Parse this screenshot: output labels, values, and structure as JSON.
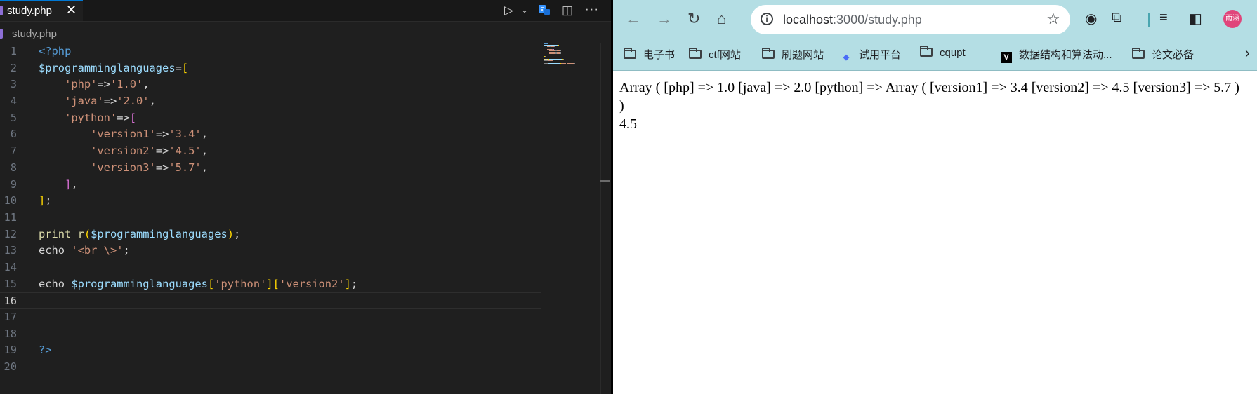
{
  "editor": {
    "tab_label": "study.php",
    "tab_close": "✕",
    "breadcrumb": "study.php",
    "toolbar": {
      "run_icon": "▷",
      "run_menu": "⌄",
      "split_icon": "◫",
      "more_icon": "···"
    },
    "current_line": 16,
    "line_numbers": [
      "1",
      "2",
      "3",
      "4",
      "5",
      "6",
      "7",
      "8",
      "9",
      "10",
      "11",
      "12",
      "13",
      "14",
      "15",
      "16",
      "17",
      "18",
      "19",
      "20"
    ],
    "code": [
      [
        [
          "<?php",
          "php"
        ]
      ],
      [
        [
          "$programminglanguages",
          "var"
        ],
        [
          "=",
          "op"
        ],
        [
          "[",
          "br1"
        ]
      ],
      [
        [
          "    ",
          "op"
        ],
        [
          "'php'",
          "str"
        ],
        [
          "=>",
          "op"
        ],
        [
          "'1.0'",
          "str"
        ],
        [
          ",",
          "op"
        ]
      ],
      [
        [
          "    ",
          "op"
        ],
        [
          "'java'",
          "str"
        ],
        [
          "=>",
          "op"
        ],
        [
          "'2.0'",
          "str"
        ],
        [
          ",",
          "op"
        ]
      ],
      [
        [
          "    ",
          "op"
        ],
        [
          "'python'",
          "str"
        ],
        [
          "=>",
          "op"
        ],
        [
          "[",
          "br2"
        ]
      ],
      [
        [
          "        ",
          "op"
        ],
        [
          "'version1'",
          "str"
        ],
        [
          "=>",
          "op"
        ],
        [
          "'3.4'",
          "str"
        ],
        [
          ",",
          "op"
        ]
      ],
      [
        [
          "        ",
          "op"
        ],
        [
          "'version2'",
          "str"
        ],
        [
          "=>",
          "op"
        ],
        [
          "'4.5'",
          "str"
        ],
        [
          ",",
          "op"
        ]
      ],
      [
        [
          "        ",
          "op"
        ],
        [
          "'version3'",
          "str"
        ],
        [
          "=>",
          "op"
        ],
        [
          "'5.7'",
          "str"
        ],
        [
          ",",
          "op"
        ]
      ],
      [
        [
          "    ",
          "op"
        ],
        [
          "]",
          "br2"
        ],
        [
          ",",
          "op"
        ]
      ],
      [
        [
          "]",
          "br1"
        ],
        [
          ";",
          "op"
        ]
      ],
      [],
      [
        [
          "print_r",
          "fn"
        ],
        [
          "(",
          "br1"
        ],
        [
          "$programminglanguages",
          "var"
        ],
        [
          ")",
          "br1"
        ],
        [
          ";",
          "op"
        ]
      ],
      [
        [
          "echo ",
          "op"
        ],
        [
          "'<br \\>'",
          "str"
        ],
        [
          ";",
          "op"
        ]
      ],
      [],
      [
        [
          "echo ",
          "op"
        ],
        [
          "$programminglanguages",
          "var"
        ],
        [
          "[",
          "br1"
        ],
        [
          "'python'",
          "str"
        ],
        [
          "]",
          "br1"
        ],
        [
          "[",
          "br1"
        ],
        [
          "'version2'",
          "str"
        ],
        [
          "]",
          "br1"
        ],
        [
          ";",
          "op"
        ]
      ],
      [],
      [],
      [],
      [
        [
          "?>",
          "php"
        ]
      ],
      []
    ]
  },
  "browser": {
    "nav": {
      "back_icon": "←",
      "forward_icon": "→",
      "reload_icon": "↻",
      "home_icon": "⌂"
    },
    "site_info_icon": "i",
    "url_host": "localhost",
    "url_path": ":3000/study.php",
    "star_icon": "☆",
    "ext_icon": "◉",
    "extensions_icon": "⧉",
    "media_icon": "≡",
    "sidepanel_icon": "◧",
    "avatar_text": "雨涵",
    "bookmarks": [
      {
        "label": "电子书",
        "icon": "folder"
      },
      {
        "label": "ctf网站",
        "icon": "folder"
      },
      {
        "label": "刷题网站",
        "icon": "folder"
      },
      {
        "label": "试用平台",
        "icon": "diamond"
      },
      {
        "label": "cqupt",
        "icon": "folder"
      },
      {
        "label": "数据结构和算法动...",
        "icon": "va-logo"
      },
      {
        "label": "论文必备",
        "icon": "folder"
      }
    ],
    "bookmarks_more": "›",
    "page_text": "Array ( [php] => 1.0 [java] => 2.0 [python] => Array ( [version1] => 3.4 [version2] => 4.5 [version3] => 5.7 ) )",
    "page_text2": "4.5"
  }
}
